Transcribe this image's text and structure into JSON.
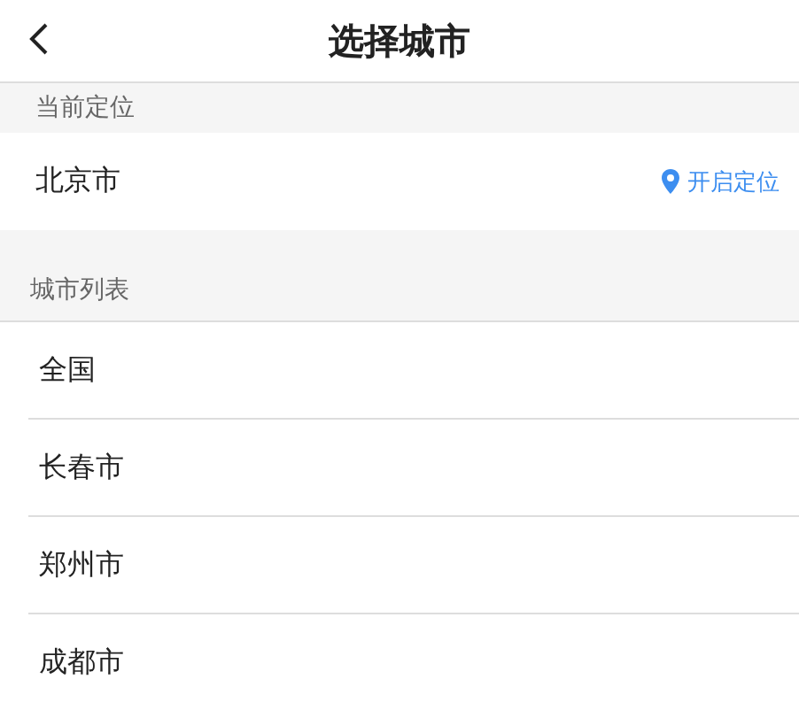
{
  "header": {
    "title": "选择城市"
  },
  "current_location": {
    "section_label": "当前定位",
    "city": "北京市",
    "action": "开启定位"
  },
  "city_list": {
    "section_label": "城市列表",
    "items": [
      {
        "name": "全国"
      },
      {
        "name": "长春市"
      },
      {
        "name": "郑州市"
      },
      {
        "name": "成都市"
      }
    ]
  }
}
